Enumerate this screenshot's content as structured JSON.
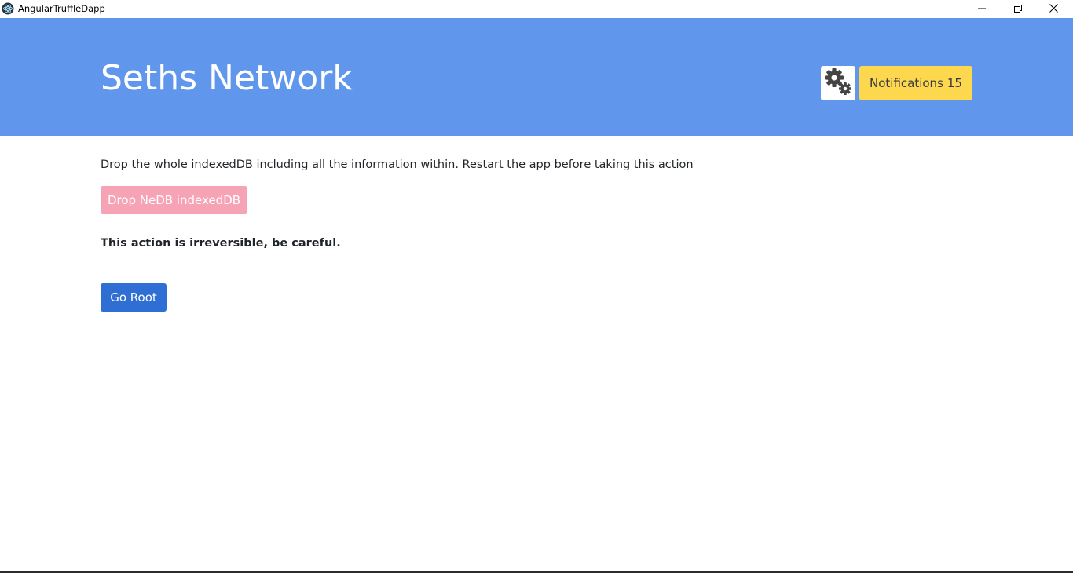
{
  "window": {
    "title": "AngularTruffleDapp",
    "app_icon": "electron-atom-icon",
    "controls": [
      "minimize-icon",
      "restore-icon",
      "close-icon"
    ]
  },
  "header": {
    "brand": "Seths Network",
    "settings_icon": "gears-icon",
    "notifications": {
      "label": "Notifications",
      "count": "15"
    },
    "colors": {
      "header_bg": "#6096eb",
      "notifications_bg": "#fdd84e"
    }
  },
  "main": {
    "description": "Drop the whole indexedDB including all the information within. Restart the app before taking this action",
    "drop_button_label": "Drop NeDB indexedDB",
    "warning": "This action is irreversible, be careful.",
    "go_root_label": "Go Root",
    "colors": {
      "drop_button_bg": "#f5a3b5",
      "go_root_bg": "#2f6fd4"
    }
  }
}
